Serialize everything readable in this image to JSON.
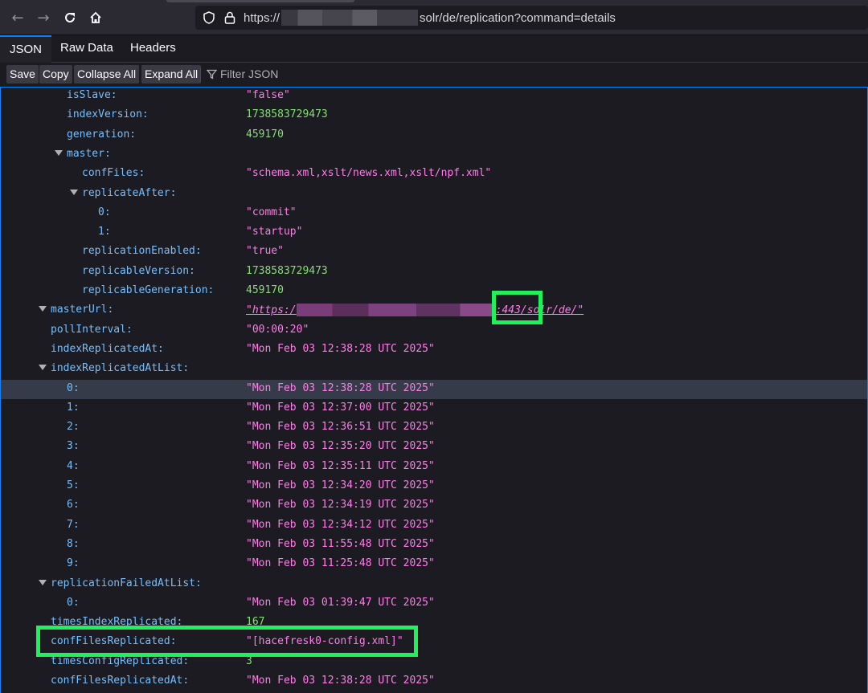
{
  "browser": {
    "url_prefix": "https://",
    "url_suffix": "solr/de/replication?command=details"
  },
  "viewer": {
    "tabs": [
      {
        "label": "JSON"
      },
      {
        "label": "Raw Data"
      },
      {
        "label": "Headers"
      }
    ],
    "buttons": {
      "save": "Save",
      "copy": "Copy",
      "collapse_all": "Collapse All",
      "expand_all": "Expand All",
      "filter_placeholder": "Filter JSON"
    }
  },
  "tree": {
    "rows": [
      {
        "key": "isSlave:",
        "value": "\"false\"",
        "type": "str"
      },
      {
        "key": "indexVersion:",
        "value": "1738583729473",
        "type": "num"
      },
      {
        "key": "generation:",
        "value": "459170",
        "type": "num"
      },
      {
        "key": "master:",
        "value": "",
        "type": "obj"
      },
      {
        "key": "confFiles:",
        "value": "\"schema.xml,xslt/news.xml,xslt/npf.xml\"",
        "type": "str"
      },
      {
        "key": "replicateAfter:",
        "value": "",
        "type": "obj"
      },
      {
        "key": "0:",
        "value": "\"commit\"",
        "type": "str"
      },
      {
        "key": "1:",
        "value": "\"startup\"",
        "type": "str"
      },
      {
        "key": "replicationEnabled:",
        "value": "\"true\"",
        "type": "str"
      },
      {
        "key": "replicableVersion:",
        "value": "1738583729473",
        "type": "num"
      },
      {
        "key": "replicableGeneration:",
        "value": "459170",
        "type": "num"
      },
      {
        "key": "masterUrl:",
        "value_prefix": "\"",
        "link_start": "https:/",
        "link_end": ":443/solr/de/",
        "value_suffix": "\"",
        "type": "url"
      },
      {
        "key": "pollInterval:",
        "value": "\"00:00:20\"",
        "type": "str"
      },
      {
        "key": "indexReplicatedAt:",
        "value": "\"Mon Feb 03 12:38:28 UTC 2025\"",
        "type": "str"
      },
      {
        "key": "indexReplicatedAtList:",
        "value": "",
        "type": "obj"
      },
      {
        "key": "0:",
        "value": "\"Mon Feb 03 12:38:28 UTC 2025\"",
        "type": "str"
      },
      {
        "key": "1:",
        "value": "\"Mon Feb 03 12:37:00 UTC 2025\"",
        "type": "str"
      },
      {
        "key": "2:",
        "value": "\"Mon Feb 03 12:36:51 UTC 2025\"",
        "type": "str"
      },
      {
        "key": "3:",
        "value": "\"Mon Feb 03 12:35:20 UTC 2025\"",
        "type": "str"
      },
      {
        "key": "4:",
        "value": "\"Mon Feb 03 12:35:11 UTC 2025\"",
        "type": "str"
      },
      {
        "key": "5:",
        "value": "\"Mon Feb 03 12:34:20 UTC 2025\"",
        "type": "str"
      },
      {
        "key": "6:",
        "value": "\"Mon Feb 03 12:34:19 UTC 2025\"",
        "type": "str"
      },
      {
        "key": "7:",
        "value": "\"Mon Feb 03 12:34:12 UTC 2025\"",
        "type": "str"
      },
      {
        "key": "8:",
        "value": "\"Mon Feb 03 11:55:48 UTC 2025\"",
        "type": "str"
      },
      {
        "key": "9:",
        "value": "\"Mon Feb 03 11:25:48 UTC 2025\"",
        "type": "str"
      },
      {
        "key": "replicationFailedAtList:",
        "value": "",
        "type": "obj"
      },
      {
        "key": "0:",
        "value": "\"Mon Feb 03 01:39:47 UTC 2025\"",
        "type": "str"
      },
      {
        "key": "timesIndexReplicated:",
        "value": "167",
        "type": "num"
      },
      {
        "key": "confFilesReplicated:",
        "value": "\"[hacefresk0-config.xml]\"",
        "type": "str"
      },
      {
        "key": "timesConfigReplicated:",
        "value": "3",
        "type": "num"
      },
      {
        "key": "confFilesReplicatedAt:",
        "value": "\"Mon Feb 03 12:38:28 UTC 2025\"",
        "type": "str"
      }
    ]
  }
}
